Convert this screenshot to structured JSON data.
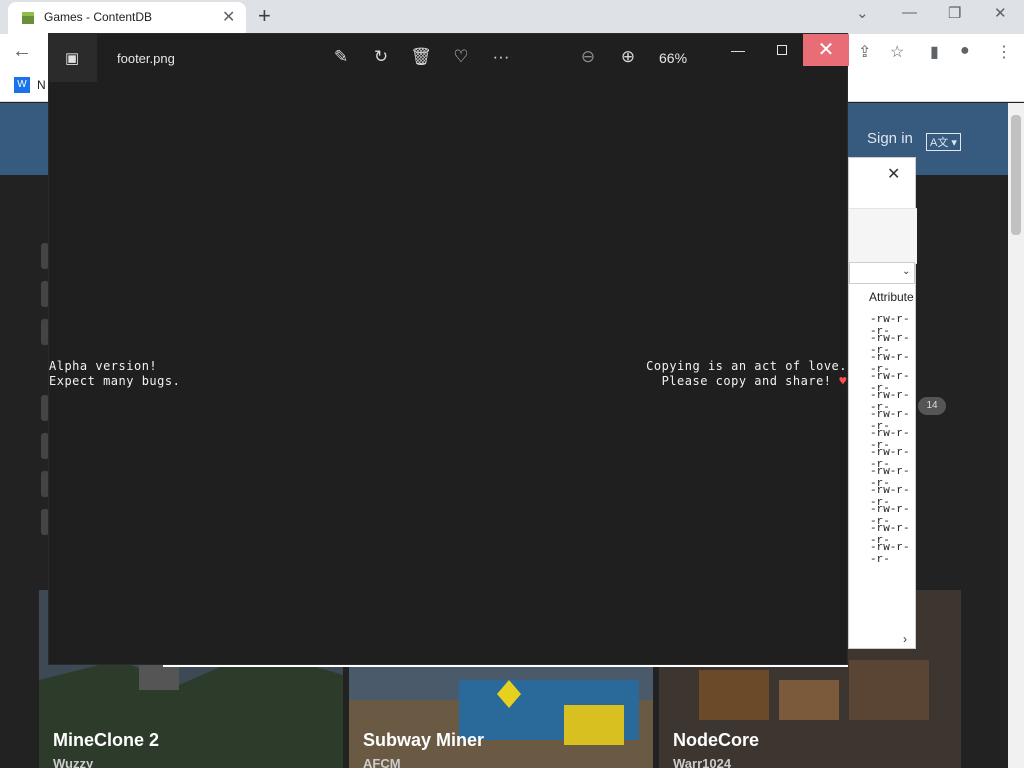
{
  "browser": {
    "tab_title": "Games - ContentDB",
    "bookmark_label": "N",
    "bookmark_icon": "W"
  },
  "site": {
    "sign_in": "Sign in",
    "badge_count": "14",
    "cards": [
      {
        "name": "MineClone 2",
        "author": "Wuzzy"
      },
      {
        "name": "Subway Miner",
        "author": "AFCM"
      },
      {
        "name": "NodeCore",
        "author": "Warr1024"
      }
    ]
  },
  "explorer": {
    "attributes_header": "Attribute",
    "attr_rows": [
      "-rw-r--r-",
      "-rw-r--r-",
      "-rw-r--r-",
      "-rw-r--r-",
      "-rw-r--r-",
      "-rw-r--r-",
      "-rw-r--r-",
      "-rw-r--r-",
      "-rw-r--r-",
      "-rw-r--r-",
      "-rw-r--r-",
      "-rw-r--r-",
      "-rw-r--r-"
    ]
  },
  "viewer": {
    "file_name": "footer.png",
    "zoom": "66%",
    "image_left_line1": "Alpha version!",
    "image_left_line2": "Expect many bugs.",
    "image_right_line1": "Copying is an act of love.",
    "image_right_line2": "Please copy and share!"
  },
  "colors": {
    "site_header": "#375a7f",
    "viewer_bg": "#1f1f1f",
    "close_hover": "#e86d76"
  }
}
